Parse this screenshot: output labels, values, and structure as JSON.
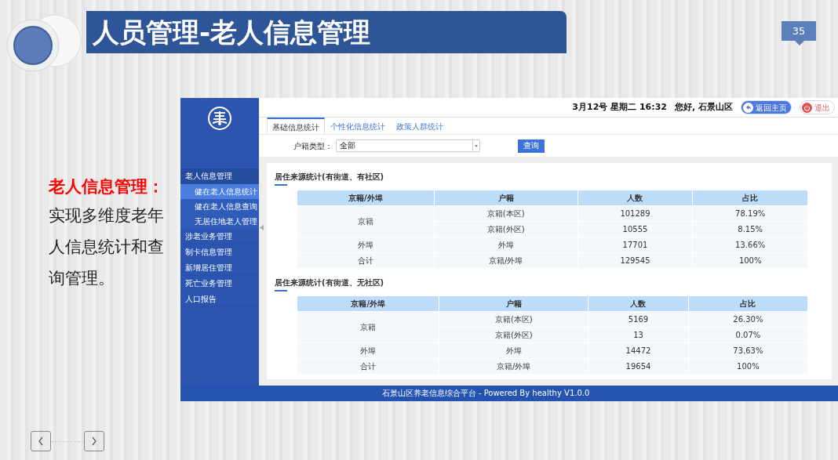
{
  "slide": {
    "title": "人员管理-老人信息管理",
    "page_number": "35"
  },
  "description": {
    "heading": "老人信息管理：",
    "text": "实现多维度老年人信息统计和查询管理。"
  },
  "app": {
    "header": {
      "datetime": "3月12号 星期二 16:32",
      "greeting": "您好, 石景山区",
      "home_button": "返回主页",
      "logout_button": "退出"
    },
    "sidebar": {
      "items": [
        {
          "label": "老人信息管理",
          "expanded": true,
          "children": [
            {
              "label": "健在老人信息统计",
              "selected": true
            },
            {
              "label": "健在老人信息查询",
              "selected": false
            },
            {
              "label": "无居住地老人管理",
              "selected": false
            }
          ]
        },
        {
          "label": "涉老业务管理",
          "expanded": false
        },
        {
          "label": "制卡信息管理",
          "expanded": false
        },
        {
          "label": "新增居住管理",
          "expanded": false
        },
        {
          "label": "死亡业务管理",
          "expanded": false
        },
        {
          "label": "人口报告",
          "expanded": false
        }
      ]
    },
    "tabs": [
      {
        "label": "基础信息统计",
        "selected": true
      },
      {
        "label": "个性化信息统计",
        "selected": false
      },
      {
        "label": "政策人群统计",
        "selected": false
      }
    ],
    "filter": {
      "label": "户籍类型：",
      "value": "全部",
      "button": "查询"
    },
    "sections": [
      {
        "title": "居住来源统计(有街道、有社区)",
        "columns": [
          "京籍/外埠",
          "户籍",
          "人数",
          "占比"
        ],
        "groups": [
          {
            "group": "京籍",
            "rows": [
              [
                "京籍(本区)",
                "101289",
                "78.19%"
              ],
              [
                "京籍(外区)",
                "10555",
                "8.15%"
              ]
            ]
          },
          {
            "group": "外埠",
            "rows": [
              [
                "外埠",
                "17701",
                "13.66%"
              ]
            ]
          },
          {
            "group": "合计",
            "rows": [
              [
                "京籍/外埠",
                "129545",
                "100%"
              ]
            ]
          }
        ]
      },
      {
        "title": "居住来源统计(有街道、无社区)",
        "columns": [
          "京籍/外埠",
          "户籍",
          "人数",
          "占比"
        ],
        "groups": [
          {
            "group": "京籍",
            "rows": [
              [
                "京籍(本区)",
                "5169",
                "26.30%"
              ],
              [
                "京籍(外区)",
                "13",
                "0.07%"
              ]
            ]
          },
          {
            "group": "外埠",
            "rows": [
              [
                "外埠",
                "14472",
                "73.63%"
              ]
            ]
          },
          {
            "group": "合计",
            "rows": [
              [
                "京籍/外埠",
                "19654",
                "100%"
              ]
            ]
          }
        ]
      }
    ],
    "footer": "石景山区养老信息综合平台 - Powered By healthy V1.0.0"
  }
}
